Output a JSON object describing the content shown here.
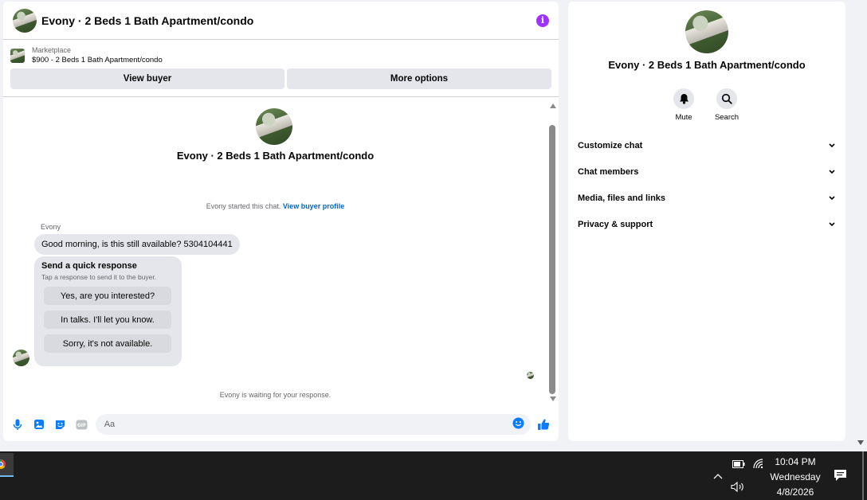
{
  "chat": {
    "title": "Evony · 2 Beds 1 Bath Apartment/condo",
    "marketplace_label": "Marketplace",
    "listing": "$900 - 2 Beds 1 Bath Apartment/condo",
    "view_buyer": "View buyer",
    "more_options": "More options",
    "center_name": "Evony · 2 Beds 1 Bath Apartment/condo",
    "started_text": "Evony started this chat.",
    "view_buyer_profile": "View buyer profile",
    "sender": "Evony",
    "message": "Good morning, is this still available? 5304104441",
    "quick_title": "Send a quick response",
    "quick_sub": "Tap a response to send it to the buyer.",
    "quick_responses": [
      "Yes, are you interested?",
      "In talks. I'll let you know.",
      "Sorry, it's not available."
    ],
    "waiting": "Evony is waiting for your response.",
    "input_placeholder": "Aa",
    "gif_label": "GIF"
  },
  "info": {
    "name": "Evony · 2 Beds 1 Bath Apartment/condo",
    "mute": "Mute",
    "search": "Search",
    "sections": [
      "Customize chat",
      "Chat members",
      "Media, files and links",
      "Privacy & support"
    ]
  },
  "taskbar": {
    "time": "10:04 PM",
    "day": "Wednesday",
    "date": "4/8/2026"
  },
  "colors": {
    "accent_blue": "#0a7cff",
    "info_purple": "#a033ff",
    "bubble_gray": "#e4e6eb"
  },
  "icons": [
    "info-icon",
    "microphone-icon",
    "image-icon",
    "sticker-icon",
    "gif-icon",
    "emoji-icon",
    "thumbs-up-icon",
    "bell-icon",
    "search-icon",
    "chevron-down-icon",
    "battery-icon",
    "wifi-icon",
    "volume-icon",
    "chevron-up-icon",
    "notification-icon",
    "chrome-icon"
  ]
}
